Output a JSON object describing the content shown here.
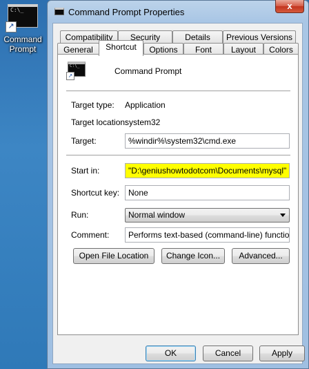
{
  "desktop": {
    "icon_label_line1": "Command",
    "icon_label_line2": "Prompt",
    "icon_name": "command-prompt-shortcut-icon"
  },
  "window": {
    "title": "Command Prompt Properties",
    "close_glyph": "x"
  },
  "tabs_row1": [
    "Compatibility",
    "Security",
    "Details",
    "Previous Versions"
  ],
  "tabs_row2": [
    "General",
    "Shortcut",
    "Options",
    "Font",
    "Layout",
    "Colors"
  ],
  "active_tab": "Shortcut",
  "shortcut": {
    "name": "Command Prompt",
    "target_type_label": "Target type:",
    "target_type_value": "Application",
    "target_location_label": "Target location:",
    "target_location_value": "system32",
    "target_label": "Target:",
    "target_value": "%windir%\\system32\\cmd.exe",
    "start_in_label": "Start in:",
    "start_in_value": "\"D:\\geniushowtodotcom\\Documents\\mysql\"",
    "shortcut_key_label": "Shortcut key:",
    "shortcut_key_value": "None",
    "run_label": "Run:",
    "run_value": "Normal window",
    "comment_label": "Comment:",
    "comment_value": "Performs text-based (command-line) functions.",
    "open_file_location": "Open File Location",
    "change_icon": "Change Icon...",
    "advanced": "Advanced..."
  },
  "dialog_buttons": {
    "ok": "OK",
    "cancel": "Cancel",
    "apply": "Apply"
  },
  "colors": {
    "highlight": "#ffff00",
    "desktop": "#2f79b8"
  }
}
